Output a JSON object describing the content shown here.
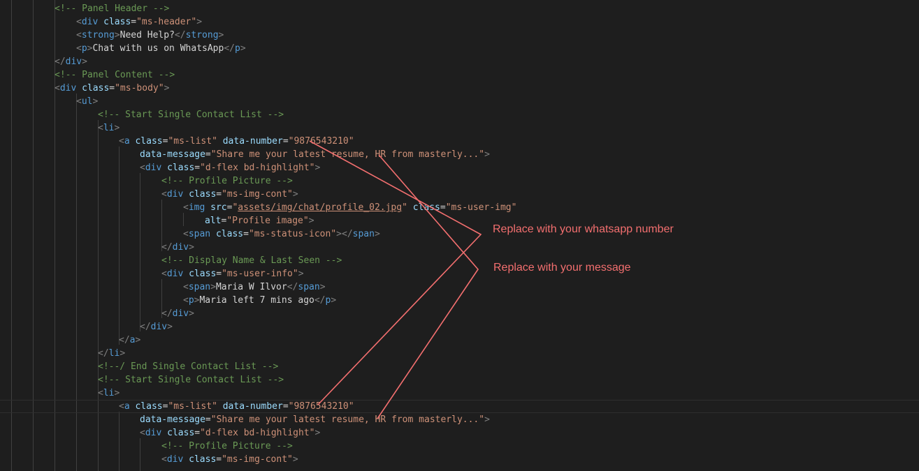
{
  "editor": {
    "lines": [
      [
        [
          "comment",
          "<!-- Panel Header -->"
        ]
      ],
      [
        [
          "punct",
          "<"
        ],
        [
          "tag",
          "div"
        ],
        [
          "text",
          " "
        ],
        [
          "attr",
          "class"
        ],
        [
          "eq",
          "="
        ],
        [
          "value",
          "\"ms-header\""
        ],
        [
          "punct",
          ">"
        ]
      ],
      [
        [
          "punct",
          "<"
        ],
        [
          "tag",
          "strong"
        ],
        [
          "punct",
          ">"
        ],
        [
          "text",
          "Need Help?"
        ],
        [
          "punct",
          "</"
        ],
        [
          "tag",
          "strong"
        ],
        [
          "punct",
          ">"
        ]
      ],
      [
        [
          "punct",
          "<"
        ],
        [
          "tag",
          "p"
        ],
        [
          "punct",
          ">"
        ],
        [
          "text",
          "Chat with us on WhatsApp"
        ],
        [
          "punct",
          "</"
        ],
        [
          "tag",
          "p"
        ],
        [
          "punct",
          ">"
        ]
      ],
      [
        [
          "punct",
          "</"
        ],
        [
          "tag",
          "div"
        ],
        [
          "punct",
          ">"
        ]
      ],
      [
        [
          "comment",
          "<!-- Panel Content -->"
        ]
      ],
      [
        [
          "punct",
          "<"
        ],
        [
          "tag",
          "div"
        ],
        [
          "text",
          " "
        ],
        [
          "attr",
          "class"
        ],
        [
          "eq",
          "="
        ],
        [
          "value",
          "\"ms-body\""
        ],
        [
          "punct",
          ">"
        ]
      ],
      [
        [
          "punct",
          "<"
        ],
        [
          "tag",
          "ul"
        ],
        [
          "punct",
          ">"
        ]
      ],
      [
        [
          "comment",
          "<!-- Start Single Contact List -->"
        ]
      ],
      [
        [
          "punct",
          "<"
        ],
        [
          "tag",
          "li"
        ],
        [
          "punct",
          ">"
        ]
      ],
      [
        [
          "punct",
          "<"
        ],
        [
          "tag",
          "a"
        ],
        [
          "text",
          " "
        ],
        [
          "attr",
          "class"
        ],
        [
          "eq",
          "="
        ],
        [
          "value",
          "\"ms-list\""
        ],
        [
          "text",
          " "
        ],
        [
          "attr",
          "data-number"
        ],
        [
          "eq",
          "="
        ],
        [
          "value",
          "\"9876543210\""
        ]
      ],
      [
        [
          "attr",
          "data-message"
        ],
        [
          "eq",
          "="
        ],
        [
          "value",
          "\"Share me your latest resume, HR from masterly...\""
        ],
        [
          "punct",
          ">"
        ]
      ],
      [
        [
          "punct",
          "<"
        ],
        [
          "tag",
          "div"
        ],
        [
          "text",
          " "
        ],
        [
          "attr",
          "class"
        ],
        [
          "eq",
          "="
        ],
        [
          "value",
          "\"d-flex bd-highlight\""
        ],
        [
          "punct",
          ">"
        ]
      ],
      [
        [
          "comment",
          "<!-- Profile Picture -->"
        ]
      ],
      [
        [
          "punct",
          "<"
        ],
        [
          "tag",
          "div"
        ],
        [
          "text",
          " "
        ],
        [
          "attr",
          "class"
        ],
        [
          "eq",
          "="
        ],
        [
          "value",
          "\"ms-img-cont\""
        ],
        [
          "punct",
          ">"
        ]
      ],
      [
        [
          "punct",
          "<"
        ],
        [
          "tag",
          "img"
        ],
        [
          "text",
          " "
        ],
        [
          "attr",
          "src"
        ],
        [
          "eq",
          "="
        ],
        [
          "value",
          "\""
        ],
        [
          "link",
          "assets/img/chat/profile_02.jpg"
        ],
        [
          "value",
          "\""
        ],
        [
          "text",
          " "
        ],
        [
          "attr",
          "class"
        ],
        [
          "eq",
          "="
        ],
        [
          "value",
          "\"ms-user-img\""
        ]
      ],
      [
        [
          "attr",
          "alt"
        ],
        [
          "eq",
          "="
        ],
        [
          "value",
          "\"Profile image\""
        ],
        [
          "punct",
          ">"
        ]
      ],
      [
        [
          "punct",
          "<"
        ],
        [
          "tag",
          "span"
        ],
        [
          "text",
          " "
        ],
        [
          "attr",
          "class"
        ],
        [
          "eq",
          "="
        ],
        [
          "value",
          "\"ms-status-icon\""
        ],
        [
          "punct",
          "></"
        ],
        [
          "tag",
          "span"
        ],
        [
          "punct",
          ">"
        ]
      ],
      [
        [
          "punct",
          "</"
        ],
        [
          "tag",
          "div"
        ],
        [
          "punct",
          ">"
        ]
      ],
      [
        [
          "comment",
          "<!-- Display Name & Last Seen -->"
        ]
      ],
      [
        [
          "punct",
          "<"
        ],
        [
          "tag",
          "div"
        ],
        [
          "text",
          " "
        ],
        [
          "attr",
          "class"
        ],
        [
          "eq",
          "="
        ],
        [
          "value",
          "\"ms-user-info\""
        ],
        [
          "punct",
          ">"
        ]
      ],
      [
        [
          "punct",
          "<"
        ],
        [
          "tag",
          "span"
        ],
        [
          "punct",
          ">"
        ],
        [
          "text",
          "Maria W Ilvor"
        ],
        [
          "punct",
          "</"
        ],
        [
          "tag",
          "span"
        ],
        [
          "punct",
          ">"
        ]
      ],
      [
        [
          "punct",
          "<"
        ],
        [
          "tag",
          "p"
        ],
        [
          "punct",
          ">"
        ],
        [
          "text",
          "Maria left 7 mins ago"
        ],
        [
          "punct",
          "</"
        ],
        [
          "tag",
          "p"
        ],
        [
          "punct",
          ">"
        ]
      ],
      [
        [
          "punct",
          "</"
        ],
        [
          "tag",
          "div"
        ],
        [
          "punct",
          ">"
        ]
      ],
      [
        [
          "punct",
          "</"
        ],
        [
          "tag",
          "div"
        ],
        [
          "punct",
          ">"
        ]
      ],
      [
        [
          "punct",
          "</"
        ],
        [
          "tag",
          "a"
        ],
        [
          "punct",
          ">"
        ]
      ],
      [
        [
          "punct",
          "</"
        ],
        [
          "tag",
          "li"
        ],
        [
          "punct",
          ">"
        ]
      ],
      [
        [
          "comment",
          "<!--/ End Single Contact List -->"
        ]
      ],
      [
        [
          "comment",
          "<!-- Start Single Contact List -->"
        ]
      ],
      [
        [
          "punct",
          "<"
        ],
        [
          "tag",
          "li"
        ],
        [
          "punct",
          ">"
        ]
      ],
      [
        [
          "punct",
          "<"
        ],
        [
          "tag",
          "a"
        ],
        [
          "text",
          " "
        ],
        [
          "attr",
          "class"
        ],
        [
          "eq",
          "="
        ],
        [
          "value",
          "\"ms-list\""
        ],
        [
          "text",
          " "
        ],
        [
          "attr",
          "data-number"
        ],
        [
          "eq",
          "="
        ],
        [
          "value",
          "\"9876543210\""
        ]
      ],
      [
        [
          "attr",
          "data-message"
        ],
        [
          "eq",
          "="
        ],
        [
          "value",
          "\"Share me your latest resume, HR from masterly...\""
        ],
        [
          "punct",
          ">"
        ]
      ],
      [
        [
          "punct",
          "<"
        ],
        [
          "tag",
          "div"
        ],
        [
          "text",
          " "
        ],
        [
          "attr",
          "class"
        ],
        [
          "eq",
          "="
        ],
        [
          "value",
          "\"d-flex bd-highlight\""
        ],
        [
          "punct",
          ">"
        ]
      ],
      [
        [
          "comment",
          "<!-- Profile Picture -->"
        ]
      ],
      [
        [
          "punct",
          "<"
        ],
        [
          "tag",
          "div"
        ],
        [
          "text",
          " "
        ],
        [
          "attr",
          "class"
        ],
        [
          "eq",
          "="
        ],
        [
          "value",
          "\"ms-img-cont\""
        ],
        [
          "punct",
          ">"
        ]
      ]
    ],
    "theme": {
      "background": "#1e1e1e",
      "comment": "#6a9955",
      "tag": "#569cd6",
      "attribute": "#9cdcfe",
      "string": "#ce9178",
      "text": "#d4d4d4"
    }
  },
  "annotations": {
    "number_note": "Replace with your whatsapp number",
    "message_note": "Replace with your message",
    "color": "#f36f6f"
  }
}
